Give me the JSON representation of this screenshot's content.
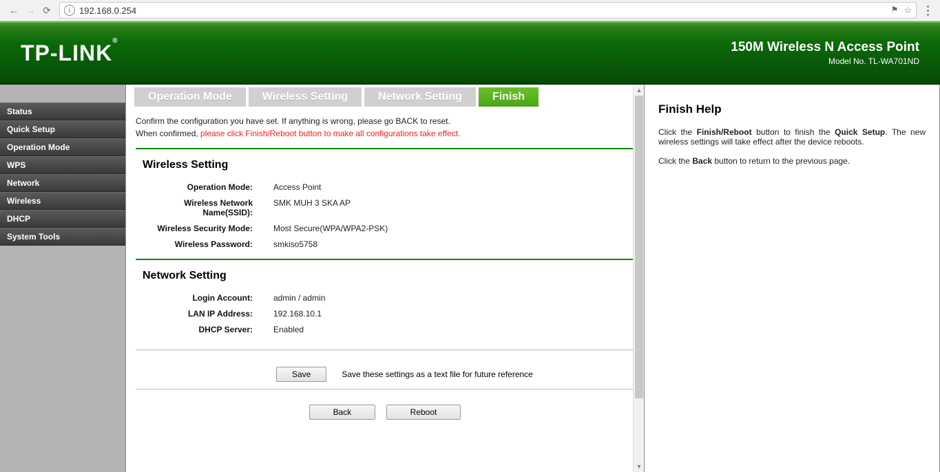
{
  "browser": {
    "url": "192.168.0.254"
  },
  "banner": {
    "logo": "TP-LINK",
    "product": "150M Wireless N Access Point",
    "model": "Model No. TL-WA701ND"
  },
  "sidebar": {
    "items": [
      {
        "label": "Status"
      },
      {
        "label": "Quick Setup"
      },
      {
        "label": "Operation Mode"
      },
      {
        "label": "WPS"
      },
      {
        "label": "Network"
      },
      {
        "label": "Wireless"
      },
      {
        "label": "DHCP"
      },
      {
        "label": "System Tools"
      }
    ]
  },
  "steps": [
    {
      "label": "Operation Mode"
    },
    {
      "label": "Wireless Setting"
    },
    {
      "label": "Network Setting"
    },
    {
      "label": "Finish",
      "active": true
    }
  ],
  "confirm": {
    "line1": "Confirm the configuration you have set. If anything is wrong, please go BACK to reset.",
    "line2a": "When confirmed, ",
    "line2b": "please click Finish/Reboot button to make all configurations take effect."
  },
  "wireless": {
    "heading": "Wireless Setting",
    "rows": [
      {
        "k": "Operation Mode:",
        "v": "Access Point"
      },
      {
        "k": "Wireless Network Name(SSID):",
        "v": "SMK MUH 3 SKA AP"
      },
      {
        "k": "Wireless Security Mode:",
        "v": "Most Secure(WPA/WPA2-PSK)"
      },
      {
        "k": "Wireless Password:",
        "v": "smkiso5758"
      }
    ]
  },
  "network": {
    "heading": "Network Setting",
    "rows": [
      {
        "k": "Login Account:",
        "v": "admin / admin"
      },
      {
        "k": "LAN IP Address:",
        "v": "192.168.10.1"
      },
      {
        "k": "DHCP Server:",
        "v": "Enabled"
      }
    ]
  },
  "save": {
    "button": "Save",
    "hint": "Save these settings as a text file for future reference"
  },
  "actions": {
    "back": "Back",
    "reboot": "Reboot"
  },
  "help": {
    "title": "Finish Help",
    "p1a": "Click the ",
    "p1b": "Finish/Reboot",
    "p1c": " button to finish the ",
    "p1d": "Quick Setup",
    "p1e": ". The new wireless settings will take effect after the device reboots.",
    "p2a": "Click the ",
    "p2b": "Back",
    "p2c": " button to return to the previous page."
  }
}
